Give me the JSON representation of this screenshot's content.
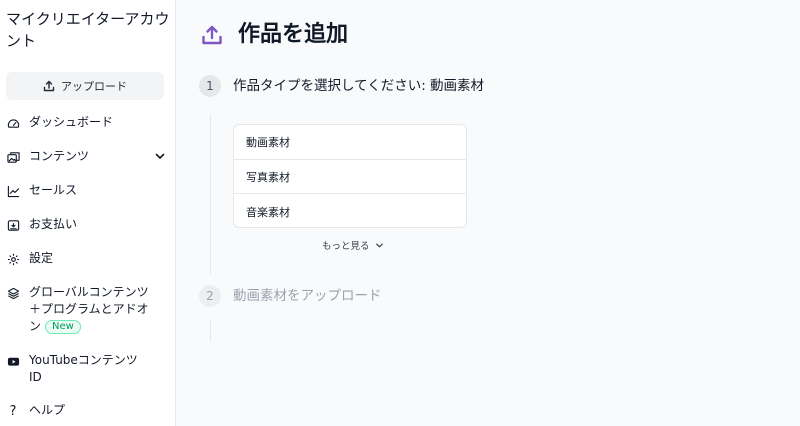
{
  "sidebar": {
    "account_name": "マイクリエイターアカウント",
    "upload_label": "アップロード",
    "items": [
      {
        "label": "ダッシュボード",
        "icon": "gauge-icon"
      },
      {
        "label": "コンテンツ",
        "icon": "images-icon"
      },
      {
        "label": "セールス",
        "icon": "chart-line-icon"
      },
      {
        "label": "お支払い",
        "icon": "wallet-icon"
      },
      {
        "label": "設定",
        "icon": "gear-icon"
      },
      {
        "label": "グローバルコンテンツ＋プログラムとアドオン",
        "icon": "layers-icon",
        "badge": "New"
      },
      {
        "label": "YouTubeコンテンツID",
        "icon": "youtube-icon"
      },
      {
        "label": "ヘルプ",
        "icon": "question-icon"
      }
    ]
  },
  "main": {
    "title": "作品を追加",
    "accent_color": "#7e57c2",
    "steps": [
      {
        "number": "1",
        "title": "作品タイプを選択してください: 動画素材"
      },
      {
        "number": "2",
        "title": "動画素材をアップロード"
      }
    ],
    "options": [
      "動画素材",
      "写真素材",
      "音楽素材"
    ],
    "more_label": "もっと見る"
  }
}
